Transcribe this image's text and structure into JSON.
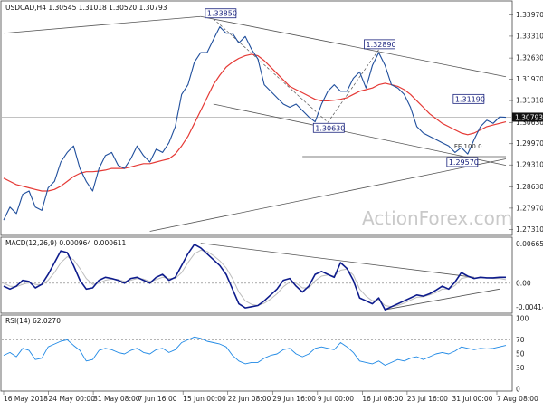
{
  "chart_data": [
    {
      "type": "line",
      "panel": "price",
      "title": "USDCAD,H4  1.30545 1.31018 1.30520 1.30793",
      "watermark": "ActionForex.com",
      "y_ticks": [
        "1.33970",
        "1.33310",
        "1.32630",
        "1.31970",
        "1.31310",
        "1.30630",
        "1.29970",
        "1.29310",
        "1.28630",
        "1.27970",
        "1.27310"
      ],
      "ylim": [
        1.2718,
        1.3432
      ],
      "last_price_label": "1.30793",
      "last_price": 1.30793,
      "x_labels": [
        "16 May 2018",
        "24 May 00:00",
        "31 May 08:00",
        "7 Jun 16:00",
        "15 Jun 00:00",
        "22 Jun 08:00",
        "29 Jun 16:00",
        "9 Jul 00:00",
        "16 Jul 08:00",
        "23 Jul 16:00",
        "31 Jul 00:00",
        "7 Aug 08:00"
      ],
      "annotations": [
        {
          "label": "1.33850",
          "value": 1.3385
        },
        {
          "label": "1.32890",
          "value": 1.3289
        },
        {
          "label": "1.31190",
          "value": 1.3119
        },
        {
          "label": "1.30630",
          "value": 1.3063
        },
        {
          "label": "1.29570",
          "value": 1.2957
        }
      ],
      "fe_label": "FE 100.0",
      "series": [
        {
          "kind": "price",
          "color": "#1f4e9c",
          "values": [
            1.276,
            1.28,
            1.278,
            1.284,
            1.285,
            1.28,
            1.279,
            1.286,
            1.288,
            1.294,
            1.297,
            1.299,
            1.292,
            1.288,
            1.285,
            1.292,
            1.296,
            1.297,
            1.293,
            1.292,
            1.295,
            1.299,
            1.296,
            1.294,
            1.298,
            1.297,
            1.3,
            1.305,
            1.315,
            1.318,
            1.325,
            1.328,
            1.328,
            1.332,
            1.336,
            1.334,
            1.334,
            1.331,
            1.333,
            1.329,
            1.326,
            1.318,
            1.316,
            1.314,
            1.312,
            1.311,
            1.312,
            1.31,
            1.308,
            1.3065,
            1.312,
            1.316,
            1.318,
            1.316,
            1.316,
            1.32,
            1.322,
            1.317,
            1.324,
            1.328,
            1.324,
            1.318,
            1.317,
            1.315,
            1.311,
            1.305,
            1.303,
            1.302,
            1.301,
            1.3,
            1.299,
            1.297,
            1.2985,
            1.2965,
            1.301,
            1.305,
            1.307,
            1.306,
            1.308,
            1.3079
          ]
        },
        {
          "kind": "moving-average",
          "color": "#e53935",
          "values": [
            1.289,
            1.288,
            1.287,
            1.2865,
            1.286,
            1.2855,
            1.285,
            1.285,
            1.2855,
            1.2865,
            1.288,
            1.2895,
            1.2905,
            1.291,
            1.291,
            1.2912,
            1.2915,
            1.292,
            1.292,
            1.292,
            1.2925,
            1.293,
            1.2935,
            1.2935,
            1.294,
            1.2945,
            1.295,
            1.2965,
            1.299,
            1.302,
            1.306,
            1.31,
            1.314,
            1.318,
            1.321,
            1.3235,
            1.325,
            1.3262,
            1.327,
            1.3275,
            1.327,
            1.3255,
            1.3235,
            1.3215,
            1.3195,
            1.3175,
            1.3165,
            1.3155,
            1.3145,
            1.3135,
            1.313,
            1.313,
            1.3132,
            1.3135,
            1.314,
            1.315,
            1.316,
            1.3165,
            1.317,
            1.318,
            1.3185,
            1.318,
            1.3175,
            1.3165,
            1.315,
            1.313,
            1.311,
            1.309,
            1.3075,
            1.306,
            1.305,
            1.304,
            1.303,
            1.3025,
            1.303,
            1.304,
            1.305,
            1.3055,
            1.306,
            1.3065
          ]
        }
      ]
    },
    {
      "type": "line",
      "panel": "macd",
      "title": "MACD(12,26,9) 0.000964 0.000611",
      "y_ticks": [
        "0.006651",
        "0.00",
        "-0.004145"
      ],
      "ylim": [
        -0.0048,
        0.0072
      ],
      "series": [
        {
          "kind": "macd",
          "color": "#0d1b8c",
          "values": [
            -0.0005,
            -0.001,
            -0.0005,
            0.0005,
            0.0003,
            -0.0008,
            -0.0002,
            0.0015,
            0.0035,
            0.0055,
            0.0052,
            0.003,
            0.0005,
            -0.001,
            -0.0008,
            0.0005,
            0.001,
            0.0008,
            0.0005,
            0.0,
            0.0008,
            0.001,
            0.0005,
            0.0,
            0.001,
            0.0015,
            0.0005,
            0.001,
            0.003,
            0.005,
            0.0066,
            0.006,
            0.005,
            0.004,
            0.003,
            0.0015,
            -0.001,
            -0.0035,
            -0.0042,
            -0.004,
            -0.0038,
            -0.003,
            -0.002,
            -0.001,
            0.0005,
            0.0008,
            -0.0005,
            -0.0015,
            -0.0005,
            0.0015,
            0.002,
            0.0015,
            0.001,
            0.0035,
            0.0025,
            0.0005,
            -0.0025,
            -0.003,
            -0.0035,
            -0.0025,
            -0.0045,
            -0.004,
            -0.0035,
            -0.003,
            -0.0025,
            -0.002,
            -0.0022,
            -0.0018,
            -0.0012,
            -0.0005,
            -0.001,
            0.0002,
            0.0018,
            0.0012,
            0.0008,
            0.001,
            0.0009,
            0.0009,
            0.001,
            0.001
          ]
        },
        {
          "kind": "signal",
          "color": "#bdbdbd",
          "values": [
            0.0,
            -0.0005,
            -0.0006,
            -0.0002,
            0.0001,
            -0.0002,
            -0.0003,
            0.0005,
            0.0018,
            0.0035,
            0.0045,
            0.004,
            0.0025,
            0.0008,
            -0.0002,
            0.0,
            0.0005,
            0.0007,
            0.0006,
            0.0003,
            0.0005,
            0.0008,
            0.0007,
            0.0003,
            0.0006,
            0.001,
            0.0008,
            0.0008,
            0.0018,
            0.0035,
            0.005,
            0.0056,
            0.0054,
            0.0047,
            0.0038,
            0.0026,
            0.0008,
            -0.0015,
            -0.003,
            -0.0036,
            -0.0038,
            -0.0034,
            -0.0027,
            -0.0018,
            -0.0006,
            0.0002,
            0.0,
            -0.0008,
            -0.0008,
            0.0004,
            0.0012,
            0.0014,
            0.0012,
            0.0022,
            0.0024,
            0.0014,
            -0.001,
            -0.0022,
            -0.003,
            -0.0028,
            -0.0038,
            -0.004,
            -0.0038,
            -0.0034,
            -0.0029,
            -0.0024,
            -0.0023,
            -0.002,
            -0.0016,
            -0.001,
            -0.001,
            -0.0004,
            0.0008,
            0.001,
            0.0009,
            0.0009,
            0.0009,
            0.0008,
            0.0008,
            0.0006
          ]
        }
      ]
    },
    {
      "type": "line",
      "panel": "rsi",
      "title": "RSI(14) 62.0270",
      "y_ticks": [
        "100",
        "70",
        "50",
        "30",
        "0"
      ],
      "ylim": [
        0,
        100
      ],
      "series": [
        {
          "kind": "rsi",
          "color": "#1e88e5",
          "values": [
            48,
            52,
            46,
            58,
            55,
            42,
            44,
            60,
            64,
            68,
            70,
            62,
            55,
            40,
            42,
            55,
            58,
            56,
            52,
            50,
            55,
            58,
            52,
            50,
            56,
            58,
            52,
            56,
            66,
            70,
            74,
            72,
            68,
            66,
            64,
            60,
            48,
            40,
            36,
            38,
            38,
            44,
            48,
            50,
            56,
            58,
            50,
            46,
            50,
            58,
            60,
            58,
            56,
            66,
            60,
            52,
            40,
            38,
            36,
            40,
            34,
            38,
            42,
            40,
            44,
            46,
            42,
            46,
            50,
            52,
            50,
            54,
            60,
            58,
            56,
            58,
            57,
            58,
            60,
            62
          ]
        }
      ]
    }
  ]
}
